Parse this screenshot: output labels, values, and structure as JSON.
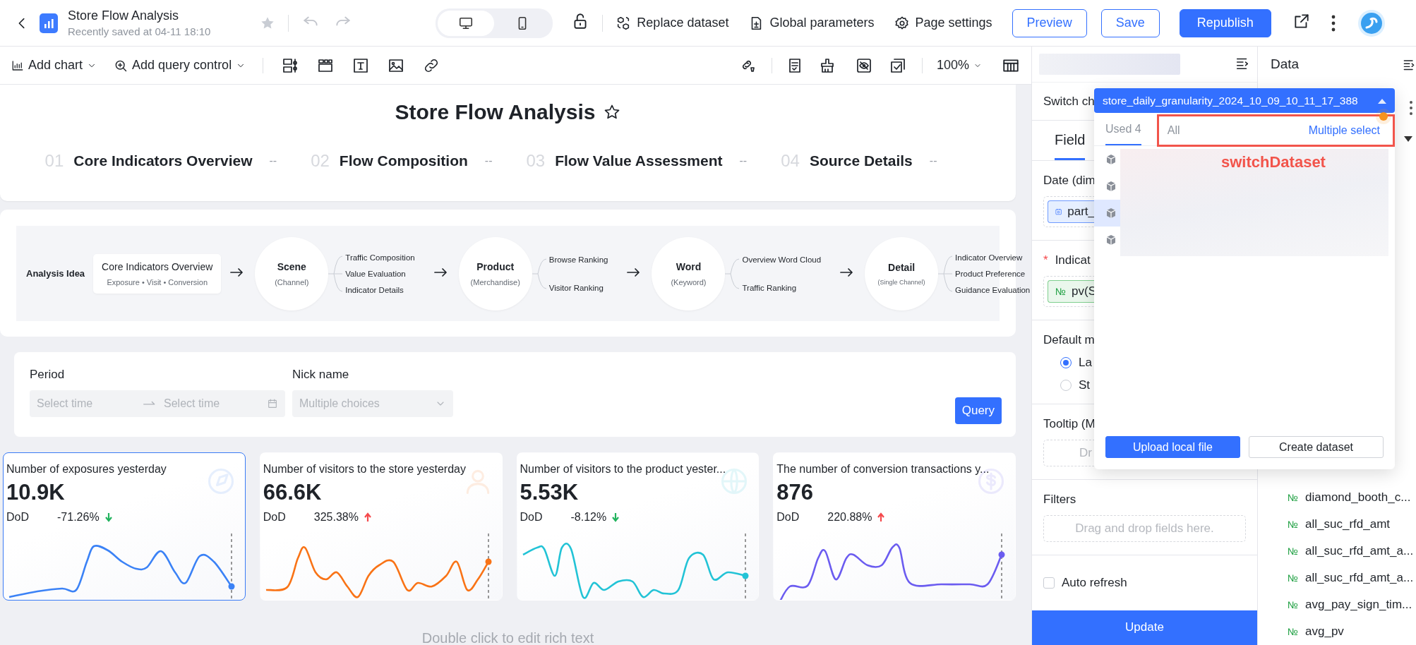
{
  "header": {
    "title": "Store Flow Analysis",
    "saved": "Recently saved at 04-11 18:10",
    "favorited": false,
    "view_modes": [
      {
        "kind": "desktop",
        "selected": true
      },
      {
        "kind": "mobile",
        "selected": false
      }
    ],
    "actions": [
      {
        "kind": "dataset",
        "label": "Replace dataset"
      },
      {
        "kind": "parameters",
        "label": "Global parameters"
      },
      {
        "kind": "settings",
        "label": "Page settings"
      }
    ],
    "buttons": [
      {
        "label": "Preview",
        "kind": "outline"
      },
      {
        "label": "Save",
        "kind": "outline"
      },
      {
        "label": "Republish",
        "kind": "primary"
      }
    ]
  },
  "toolbar": {
    "add_chart": "Add chart",
    "add_query_control": "Add query control",
    "zoom": "100%"
  },
  "dashboard": {
    "title": "Store Flow Analysis",
    "nav": [
      {
        "number": "01",
        "label": "Core Indicators Overview",
        "dash": "--"
      },
      {
        "number": "02",
        "label": "Flow Composition",
        "dash": "--"
      },
      {
        "number": "03",
        "label": "Flow Value Assessment",
        "dash": "--"
      },
      {
        "number": "04",
        "label": "Source Details",
        "dash": "--"
      }
    ],
    "flow": {
      "label": "Analysis Idea",
      "start": {
        "title": "Core Indicators Overview",
        "subtitle": "Exposure • Visit • Conversion"
      },
      "stages": [
        {
          "title": "Scene",
          "subtitle": "(Channel)",
          "branches": [
            "Traffic Composition",
            "Value Evaluation",
            "Indicator Details"
          ]
        },
        {
          "title": "Product",
          "subtitle": "(Merchandise)",
          "branches": [
            "Browse Ranking",
            "Visitor Ranking"
          ]
        },
        {
          "title": "Word",
          "subtitle": "(Keyword)",
          "branches": [
            "Overview Word Cloud",
            "Traffic Ranking"
          ]
        },
        {
          "title": "Detail",
          "subtitle": "(Single Channel)",
          "branches": [
            "Indicator Overview",
            "Product Preference",
            "Guidance Evaluation"
          ]
        }
      ]
    },
    "query": {
      "fields": [
        {
          "kind": "date_range",
          "label": "Period",
          "start_placeholder": "Select time",
          "end_placeholder": "Select time"
        },
        {
          "kind": "select",
          "label": "Nick name",
          "placeholder": "Multiple choices"
        }
      ],
      "button": "Query"
    },
    "kpis": [
      {
        "title": "Number of exposures yesterday",
        "value": "10.9K",
        "compare_label": "DoD",
        "change": "-71.26%",
        "increase": false,
        "color": "#3b82f6",
        "selected": true
      },
      {
        "title": "Number of visitors to the store yesterday",
        "value": "66.6K",
        "compare_label": "DoD",
        "change": "325.38%",
        "increase": true,
        "color": "#f97316",
        "selected": false
      },
      {
        "title": "Number of visitors to the product yester...",
        "value": "5.53K",
        "compare_label": "DoD",
        "change": "-8.12%",
        "increase": false,
        "color": "#22c3d6",
        "selected": false
      },
      {
        "title": "The number of conversion transactions y...",
        "value": "876",
        "compare_label": "DoD",
        "change": "220.88%",
        "increase": true,
        "color": "#6b5cf0",
        "selected": false
      }
    ],
    "rich_text_hint": "Double click to edit rich text"
  },
  "config": {
    "switch_label": "Switch ch",
    "tab": {
      "label": "Field",
      "selected": true
    },
    "date_label": "Date (dim",
    "date_chip": "part_",
    "required_mark": "*",
    "indicator_label": "Indicat",
    "indicator_chip": {
      "type": "№",
      "name": "pv(S"
    },
    "default_label": "Default m",
    "radios": [
      {
        "label": "La",
        "selected": true
      },
      {
        "label": "St",
        "selected": false
      }
    ],
    "tooltip_label": "Tooltip (M",
    "tooltip_placeholder": "Dr",
    "filters_label": "Filters",
    "filters_placeholder": "Drag and drop fields here.",
    "auto_refresh": {
      "label": "Auto refresh",
      "checked": false
    },
    "update_button": "Update"
  },
  "data_panel": {
    "title": "Data",
    "fields": [
      {
        "type": "№",
        "name": "diamond_booth_c..."
      },
      {
        "type": "№",
        "name": "all_suc_rfd_amt"
      },
      {
        "type": "№",
        "name": "all_suc_rfd_amt_a..."
      },
      {
        "type": "№",
        "name": "all_suc_rfd_amt_a..."
      },
      {
        "type": "№",
        "name": "avg_pay_sign_tim..."
      },
      {
        "type": "№",
        "name": "avg_pv"
      }
    ]
  },
  "dataset_dropdown": {
    "value": "store_daily_granularity_2024_10_09_10_11_17_388",
    "tabs": [
      {
        "label": "Used 4",
        "selected": true
      },
      {
        "label": "All",
        "selected": false
      }
    ],
    "multiple_select": "Multiple select",
    "rows": [
      {
        "selected": false
      },
      {
        "selected": false
      },
      {
        "selected": true
      },
      {
        "selected": false
      }
    ],
    "buttons": [
      {
        "label": "Upload local file",
        "kind": "primary"
      },
      {
        "label": "Create dataset",
        "kind": "outline"
      }
    ],
    "annotation": "switchDataset"
  }
}
